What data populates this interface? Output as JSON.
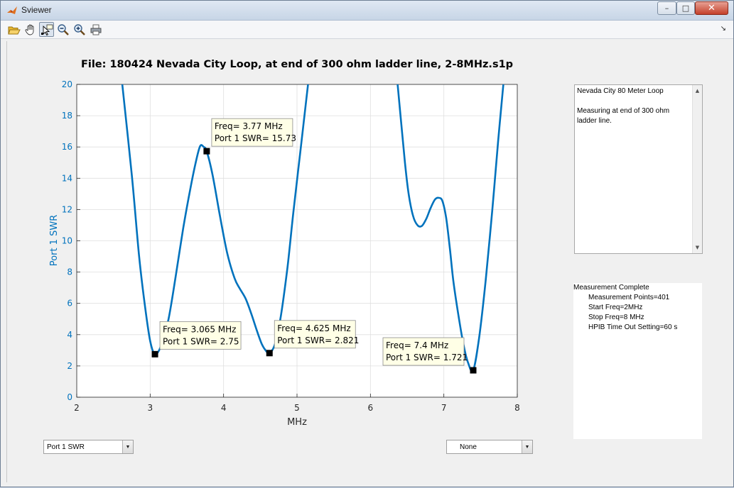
{
  "window": {
    "title": "Sviewer",
    "minimize": "–",
    "maximize": "□",
    "close": "✕"
  },
  "toolbar": {
    "tools": [
      "open-icon",
      "pan-icon",
      "data-cursor-icon",
      "zoom-out-icon",
      "zoom-in-icon",
      "print-icon"
    ],
    "overflow": "↘"
  },
  "plot": {
    "title": "File:  180424 Nevada City Loop, at end of 300 ohm ladder line, 2-8MHz.s1p",
    "xlabel": "MHz",
    "ylabel": "Port 1 SWR",
    "curve_color": "#0072BD",
    "tick_color": "#0072BD"
  },
  "chart_data": {
    "type": "line",
    "xlim": [
      2,
      8
    ],
    "ylim": [
      0,
      20
    ],
    "xticks": [
      2,
      3,
      4,
      5,
      6,
      7,
      8
    ],
    "yticks": [
      0,
      2,
      4,
      6,
      8,
      10,
      12,
      14,
      16,
      18,
      20
    ],
    "grid": true,
    "series": [
      {
        "segments": [
          [
            [
              2.62,
              20
            ],
            [
              2.75,
              14.2
            ],
            [
              2.85,
              9.0
            ],
            [
              2.93,
              5.8
            ],
            [
              3.0,
              3.6
            ],
            [
              3.065,
              2.75
            ],
            [
              3.15,
              3.3
            ],
            [
              3.25,
              5.0
            ],
            [
              3.35,
              7.8
            ],
            [
              3.45,
              10.8
            ],
            [
              3.55,
              13.4
            ],
            [
              3.62,
              15.0
            ],
            [
              3.68,
              16.05
            ],
            [
              3.73,
              16.0
            ],
            [
              3.77,
              15.73
            ],
            [
              3.85,
              14.2
            ],
            [
              3.95,
              11.6
            ],
            [
              4.05,
              9.2
            ],
            [
              4.15,
              7.6
            ],
            [
              4.22,
              6.95
            ],
            [
              4.3,
              6.3
            ],
            [
              4.38,
              5.3
            ],
            [
              4.45,
              4.3
            ],
            [
              4.52,
              3.4
            ],
            [
              4.58,
              2.95
            ],
            [
              4.625,
              2.821
            ],
            [
              4.7,
              3.4
            ],
            [
              4.78,
              5.2
            ],
            [
              4.87,
              8.3
            ],
            [
              4.95,
              11.8
            ],
            [
              5.05,
              15.9
            ],
            [
              5.15,
              20
            ]
          ],
          [
            [
              6.37,
              20
            ],
            [
              6.42,
              17.5
            ],
            [
              6.47,
              15.0
            ],
            [
              6.52,
              13.0
            ],
            [
              6.58,
              11.6
            ],
            [
              6.64,
              11.0
            ],
            [
              6.7,
              10.95
            ],
            [
              6.76,
              11.4
            ],
            [
              6.82,
              12.1
            ],
            [
              6.88,
              12.65
            ],
            [
              6.93,
              12.75
            ],
            [
              6.98,
              12.55
            ],
            [
              7.03,
              11.5
            ],
            [
              7.08,
              9.6
            ],
            [
              7.13,
              7.4
            ],
            [
              7.2,
              5.2
            ],
            [
              7.27,
              3.3
            ],
            [
              7.33,
              2.2
            ],
            [
              7.4,
              1.721
            ],
            [
              7.48,
              3.8
            ],
            [
              7.57,
              7.5
            ],
            [
              7.66,
              12.0
            ],
            [
              7.74,
              16.4
            ],
            [
              7.81,
              20
            ]
          ]
        ]
      }
    ],
    "annotations": [
      {
        "x": 3.065,
        "y": 2.75,
        "lines": [
          "Freq= 3.065 MHz",
          "Port 1 SWR= 2.75"
        ],
        "box": "above-right"
      },
      {
        "x": 3.77,
        "y": 15.73,
        "lines": [
          "Freq= 3.77 MHz",
          "Port 1 SWR= 15.73"
        ],
        "box": "above-right"
      },
      {
        "x": 4.625,
        "y": 2.821,
        "lines": [
          "Freq= 4.625 MHz",
          "Port 1 SWR= 2.821"
        ],
        "box": "above-right"
      },
      {
        "x": 7.4,
        "y": 1.721,
        "lines": [
          "Freq= 7.4 MHz",
          "Port 1 SWR= 1.721"
        ],
        "box": "above-left"
      }
    ]
  },
  "notes": {
    "text": "Nevada City 80 Meter Loop\n\nMeasuring at end of 300 ohm ladder line."
  },
  "status": {
    "heading": "Measurement Complete",
    "lines": [
      "Measurement Points=401",
      "Start Freq=2MHz",
      "Stop Freq=8 MHz",
      "HPIB Time Out Setting=60 s"
    ]
  },
  "dropdowns": {
    "left": "Port 1 SWR",
    "right": "None"
  }
}
